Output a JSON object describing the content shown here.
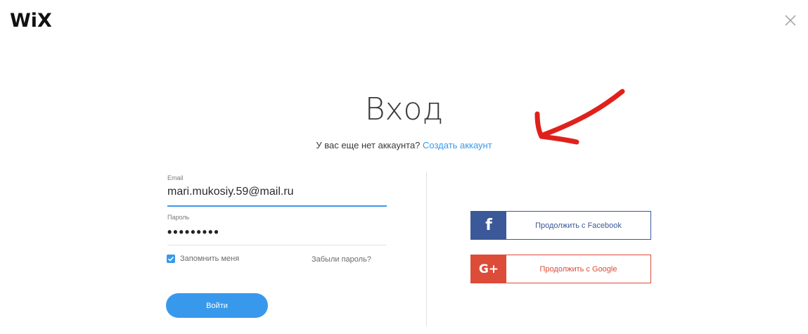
{
  "brand": {
    "logo": "WiX"
  },
  "login": {
    "title": "Вход",
    "no_account_text": "У вас еще нет аккаунта?",
    "create_account_link": "Создать аккаунт"
  },
  "email_field": {
    "label": "Email",
    "value": "mari.mukosiy.59@mail.ru"
  },
  "password_field": {
    "label": "Пароль",
    "value": "•••••••••"
  },
  "remember_me": {
    "label": "Запомнить меня",
    "checked": true
  },
  "forgot_password": {
    "label": "Забыли пароль?"
  },
  "submit": {
    "label": "Войти"
  },
  "social": {
    "facebook": {
      "icon": "f",
      "label": "Продолжить с Facebook"
    },
    "google": {
      "icon": "G+",
      "label": "Продолжить с Google"
    }
  },
  "colors": {
    "accent": "#3899ec",
    "facebook": "#3b5998",
    "google": "#dd4b39",
    "annotation_arrow": "#e0211b"
  }
}
